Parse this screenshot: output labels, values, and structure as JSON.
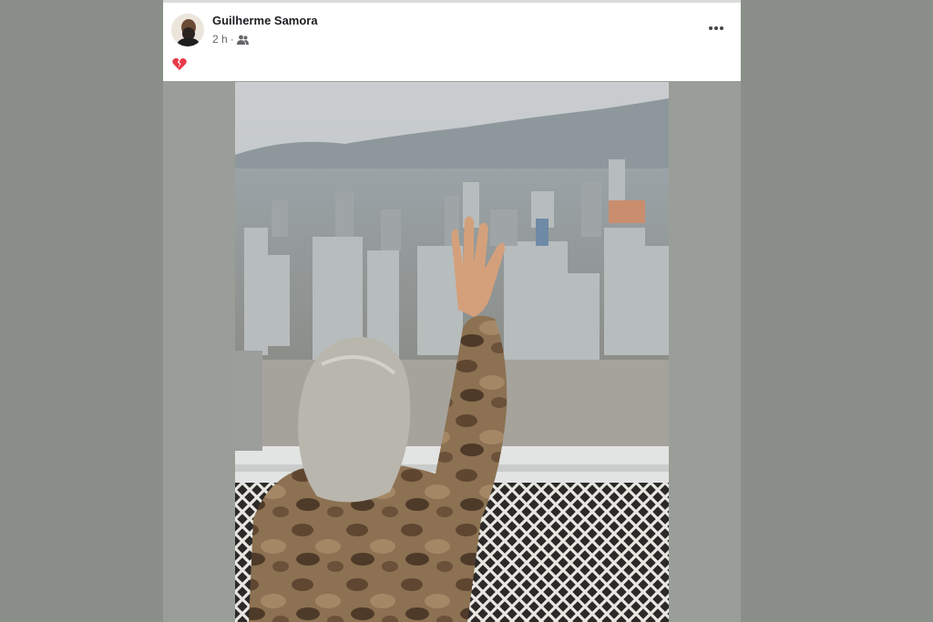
{
  "post": {
    "author": "Guilherme Samora",
    "time": "2 h",
    "separator": "·",
    "audience_icon": "friends-icon",
    "caption_icon": "broken-heart-emoji",
    "more_icon": "more-options-icon",
    "photo_description_icon": "photo"
  },
  "colors": {
    "backdrop": "#8a8f89",
    "card": "#ffffff",
    "name": "#1c1e21",
    "meta": "#65676b",
    "heart": "#e8394b"
  }
}
